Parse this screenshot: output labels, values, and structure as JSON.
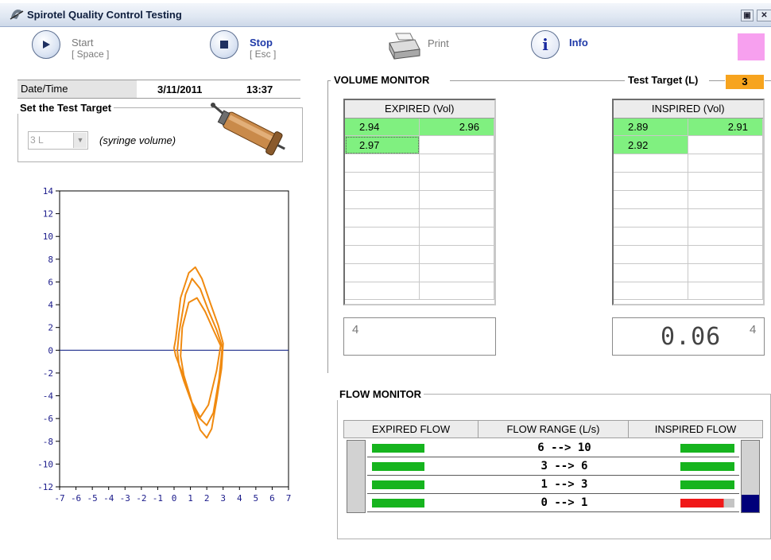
{
  "window": {
    "title": "Spirotel Quality Control Testing",
    "restore_glyph": "▣",
    "close_glyph": "✕"
  },
  "toolbar": {
    "start": {
      "label": "Start",
      "shortcut": "[ Space ]"
    },
    "stop": {
      "label": "Stop",
      "shortcut": "[ Esc ]"
    },
    "print": {
      "label": "Print"
    },
    "info": {
      "label": "Info"
    },
    "status_color": "#f7a0ef"
  },
  "datetime": {
    "label": "Date/Time",
    "date": "3/11/2011",
    "time": "13:37"
  },
  "target": {
    "legend": "Set the Test Target",
    "selected": "3 L",
    "hint": "(syringe volume)"
  },
  "chart_data": {
    "type": "line",
    "x_ticks": [
      "-7",
      "-6",
      "-5",
      "-4",
      "-3",
      "-2",
      "-1",
      "0",
      "1",
      "2",
      "3",
      "4",
      "5",
      "6",
      "7"
    ],
    "y_ticks": [
      "14",
      "12",
      "10",
      "8",
      "6",
      "4",
      "2",
      "0",
      "-2",
      "-4",
      "-6",
      "-8",
      "-10",
      "-12"
    ],
    "xlim": [
      -7,
      7
    ],
    "ylim": [
      -12,
      14
    ],
    "series_color": "#f08a10",
    "series": [
      {
        "x": [
          0.1,
          0.4,
          0.9,
          1.3,
          1.7,
          2.2,
          2.7,
          3.0,
          2.9,
          2.6,
          2.3,
          2.0,
          1.6,
          1.2,
          0.8,
          0.4,
          0.1,
          0.0,
          0.1
        ],
        "y": [
          1.0,
          4.6,
          6.8,
          7.3,
          6.3,
          4.2,
          2.2,
          0.6,
          -1.6,
          -4.4,
          -6.9,
          -7.7,
          -7.0,
          -5.2,
          -3.2,
          -1.6,
          -0.5,
          0.2,
          1.0
        ]
      },
      {
        "x": [
          0.3,
          0.7,
          1.1,
          1.6,
          2.1,
          2.6,
          2.95,
          2.75,
          2.4,
          2.0,
          1.5,
          1.0,
          0.6,
          0.3,
          0.2,
          0.3
        ],
        "y": [
          1.5,
          4.9,
          6.3,
          5.4,
          3.5,
          1.8,
          0.3,
          -2.5,
          -5.5,
          -6.6,
          -5.9,
          -4.3,
          -2.7,
          -1.3,
          0.0,
          1.5
        ]
      },
      {
        "x": [
          0.5,
          0.9,
          1.4,
          1.9,
          2.4,
          2.85,
          2.6,
          2.1,
          1.6,
          1.1,
          0.6,
          0.4,
          0.5
        ],
        "y": [
          2.0,
          4.2,
          4.6,
          3.4,
          1.8,
          0.4,
          -1.8,
          -4.8,
          -5.9,
          -4.6,
          -2.2,
          -0.5,
          2.0
        ]
      }
    ]
  },
  "volume_monitor": {
    "legend": "VOLUME MONITOR",
    "test_target_label": "Test Target (L)",
    "test_target_value": "3",
    "expired": {
      "header": "EXPIRED (Vol)",
      "rows": [
        [
          "2.94",
          "2.96"
        ],
        [
          "2.97",
          ""
        ],
        [
          "",
          ""
        ],
        [
          "",
          ""
        ],
        [
          "",
          ""
        ],
        [
          "",
          ""
        ],
        [
          "",
          ""
        ],
        [
          "",
          ""
        ],
        [
          "",
          ""
        ],
        [
          "",
          ""
        ]
      ]
    },
    "inspired": {
      "header": "INSPIRED (Vol)",
      "rows": [
        [
          "2.89",
          "2.91"
        ],
        [
          "2.92",
          ""
        ],
        [
          "",
          ""
        ],
        [
          "",
          ""
        ],
        [
          "",
          ""
        ],
        [
          "",
          ""
        ],
        [
          "",
          ""
        ],
        [
          "",
          ""
        ],
        [
          "",
          ""
        ],
        [
          "",
          ""
        ]
      ]
    },
    "expired_readout_count": "4",
    "inspired_readout_value": "0.06",
    "inspired_readout_count": "4"
  },
  "flow_monitor": {
    "legend": "FLOW MONITOR",
    "headers": {
      "expired": "EXPIRED FLOW",
      "range": "FLOW RANGE (L/s)",
      "inspired": "INSPIRED FLOW"
    },
    "ranges": [
      "6 --> 10",
      "3 --> 6",
      "1 --> 3",
      "0 --> 1"
    ],
    "inspired_last_color": "#f01818",
    "good_color": "#16b41e",
    "gauge_fill_color": "#00007a"
  }
}
